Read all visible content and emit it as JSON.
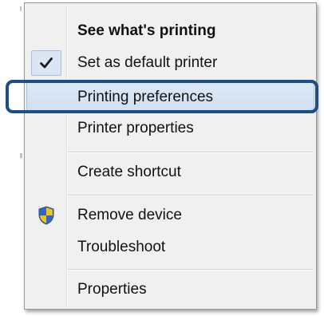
{
  "menu": {
    "items": [
      {
        "label": "See what's printing",
        "bold": true
      },
      {
        "label": "Set as default printer",
        "icon": "checkmark-icon",
        "checked": true
      },
      {
        "label": "Printing preferences",
        "highlighted": true
      },
      {
        "label": "Printer properties"
      },
      {
        "label": "Create shortcut"
      },
      {
        "label": "Remove device",
        "icon": "uac-shield-icon"
      },
      {
        "label": "Troubleshoot"
      },
      {
        "label": "Properties"
      }
    ]
  },
  "colors": {
    "highlight": "#cfdff2",
    "callout": "#1d4f86",
    "menu_bg": "#f0f0f0"
  }
}
